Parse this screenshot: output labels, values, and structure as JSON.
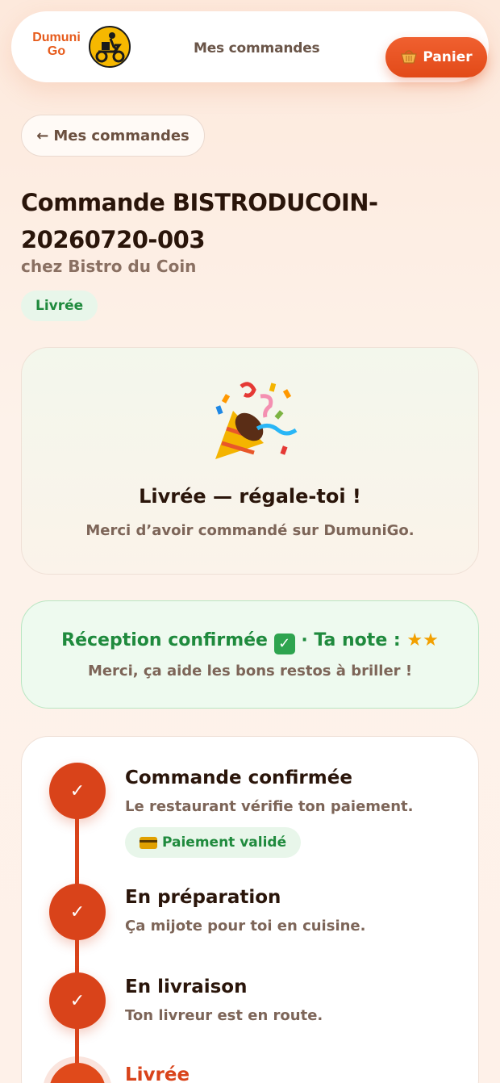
{
  "header": {
    "logo_text": "Dumuni Go",
    "nav_link": "Mes commandes",
    "cart_label": "Panier",
    "cart_icon": "basket-icon"
  },
  "back_button": {
    "arrow": "←",
    "label": "Mes commandes"
  },
  "order": {
    "title": "Commande BISTRODUCOIN-20260720-003",
    "restaurant": "chez Bistro du Coin",
    "status": "Livrée"
  },
  "celebration": {
    "icon": "party-popper-icon",
    "title": "Livrée — régale-toi !",
    "subtitle": "Merci d’avoir commandé sur DumuniGo."
  },
  "reception": {
    "confirmed_text": "Réception confirmée",
    "separator": "·",
    "rating_label": "Ta note :",
    "stars": "★★",
    "rating": 2,
    "subtitle": "Merci, ça aide les bons restos à briller !"
  },
  "timeline": {
    "steps": [
      {
        "title": "Commande confirmée",
        "desc": "Le restaurant vérifie ton paiement.",
        "badge": "Paiement validé",
        "state": "done",
        "mark": "✓"
      },
      {
        "title": "En préparation",
        "desc": "Ça mijote pour toi en cuisine.",
        "state": "done",
        "mark": "✓"
      },
      {
        "title": "En livraison",
        "desc": "Ton livreur est en route.",
        "state": "done",
        "mark": "✓"
      },
      {
        "title": "Livrée",
        "state": "current",
        "mark": ""
      }
    ]
  },
  "colors": {
    "accent": "#e24a18",
    "success": "#1f8a3d",
    "star": "#f2a000"
  }
}
